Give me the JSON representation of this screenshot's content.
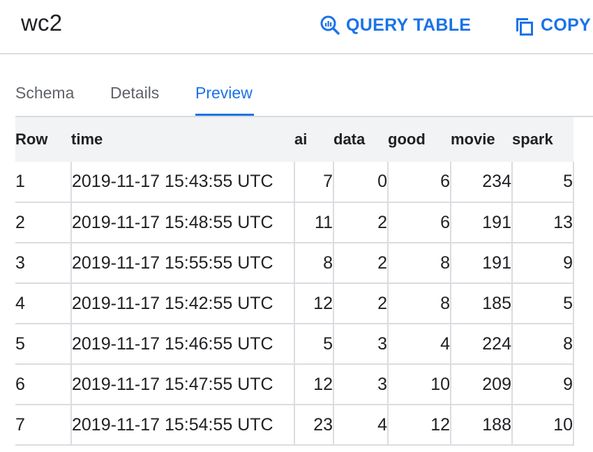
{
  "header": {
    "title": "wc2",
    "actions": [
      {
        "label": "QUERY TABLE",
        "icon": "query-search-icon"
      },
      {
        "label": "COPY T",
        "icon": "copy-icon"
      }
    ]
  },
  "tabs": [
    {
      "label": "Schema",
      "active": false
    },
    {
      "label": "Details",
      "active": false
    },
    {
      "label": "Preview",
      "active": true
    }
  ],
  "table": {
    "columns": [
      "Row",
      "time",
      "ai",
      "data",
      "good",
      "movie",
      "spark"
    ],
    "rows": [
      [
        "1",
        "2019-11-17 15:43:55 UTC",
        "7",
        "0",
        "6",
        "234",
        "5"
      ],
      [
        "2",
        "2019-11-17 15:48:55 UTC",
        "11",
        "2",
        "6",
        "191",
        "13"
      ],
      [
        "3",
        "2019-11-17 15:55:55 UTC",
        "8",
        "2",
        "8",
        "191",
        "9"
      ],
      [
        "4",
        "2019-11-17 15:42:55 UTC",
        "12",
        "2",
        "8",
        "185",
        "5"
      ],
      [
        "5",
        "2019-11-17 15:46:55 UTC",
        "5",
        "3",
        "4",
        "224",
        "8"
      ],
      [
        "6",
        "2019-11-17 15:47:55 UTC",
        "12",
        "3",
        "10",
        "209",
        "9"
      ],
      [
        "7",
        "2019-11-17 15:54:55 UTC",
        "23",
        "4",
        "12",
        "188",
        "10"
      ]
    ]
  },
  "colors": {
    "accent": "#1a73e8",
    "header_bg": "#f1f3f4",
    "border": "#dadce0",
    "text": "#202124",
    "muted": "#5f6368"
  }
}
